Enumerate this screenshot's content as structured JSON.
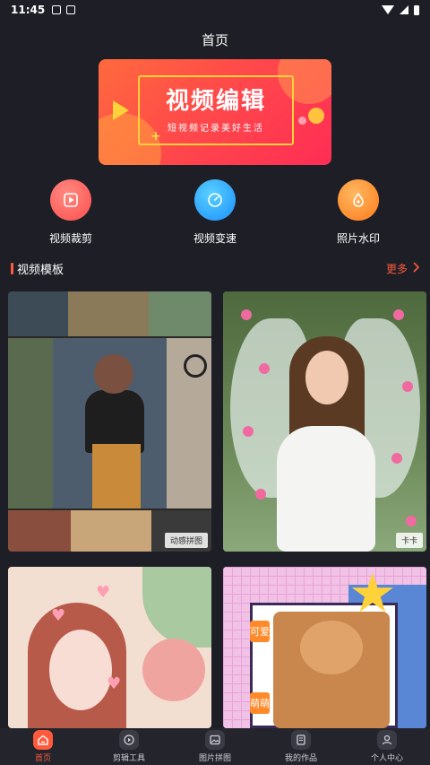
{
  "status_bar": {
    "time": "11:45"
  },
  "header": {
    "title": "首页"
  },
  "banner": {
    "title": "视频编辑",
    "subtitle": "短视频记录美好生活"
  },
  "features": [
    {
      "label": "视频裁剪",
      "icon": "play-video-icon"
    },
    {
      "label": "视频变速",
      "icon": "speedometer-icon"
    },
    {
      "label": "照片水印",
      "icon": "water-drop-icon"
    }
  ],
  "templates": {
    "section_title": "视频模板",
    "more_label": "更多",
    "items": [
      {
        "tag": "动感拼图"
      },
      {
        "tag": "卡卡"
      },
      {
        "tag": ""
      },
      {
        "tag": ""
      }
    ],
    "card4_text": {
      "top": "可爱",
      "bottom": "萌萌"
    }
  },
  "bottom_nav": [
    {
      "label": "首页",
      "icon": "home-icon",
      "active": true
    },
    {
      "label": "剪辑工具",
      "icon": "play-video-icon",
      "active": false
    },
    {
      "label": "图片拼图",
      "icon": "image-icon",
      "active": false
    },
    {
      "label": "我的作品",
      "icon": "document-icon",
      "active": false
    },
    {
      "label": "个人中心",
      "icon": "user-icon",
      "active": false
    }
  ],
  "colors": {
    "background": "#1e1f26",
    "accent": "#ff5a3c",
    "banner_gradient": [
      "#ff6a3d",
      "#ff2d55"
    ]
  }
}
